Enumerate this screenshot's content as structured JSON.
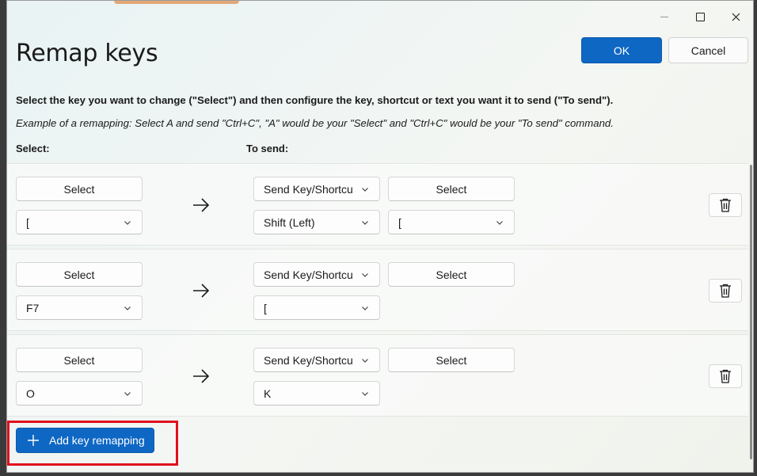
{
  "window": {
    "title": "Remap keys",
    "ok_label": "OK",
    "cancel_label": "Cancel"
  },
  "instructions": {
    "main": "Select the key you want to change (\"Select\") and then configure the key, shortcut or text you want it to send (\"To send\").",
    "example": "Example of a remapping: Select A and send \"Ctrl+C\", \"A\" would be your \"Select\" and \"Ctrl+C\" would be your \"To send\" command."
  },
  "columns": {
    "select": "Select:",
    "to_send": "To send:"
  },
  "rows": [
    {
      "select_button": "Select",
      "select_key": "[",
      "send_type": "Send Key/Shortcu",
      "send_select_button": "Select",
      "send_key_1": "Shift (Left)",
      "send_key_2": "["
    },
    {
      "select_button": "Select",
      "select_key": "F7",
      "send_type": "Send Key/Shortcu",
      "send_select_button": "Select",
      "send_key_1": "["
    },
    {
      "select_button": "Select",
      "select_key": "O",
      "send_type": "Send Key/Shortcu",
      "send_select_button": "Select",
      "send_key_1": "K"
    }
  ],
  "add_button_label": "Add key remapping",
  "colors": {
    "accent": "#0f67c4",
    "highlight": "#e0101c"
  },
  "icons": [
    "minimize-icon",
    "maximize-icon",
    "close-icon",
    "arrow-right-icon",
    "chevron-down-icon",
    "trash-icon",
    "plus-icon"
  ]
}
